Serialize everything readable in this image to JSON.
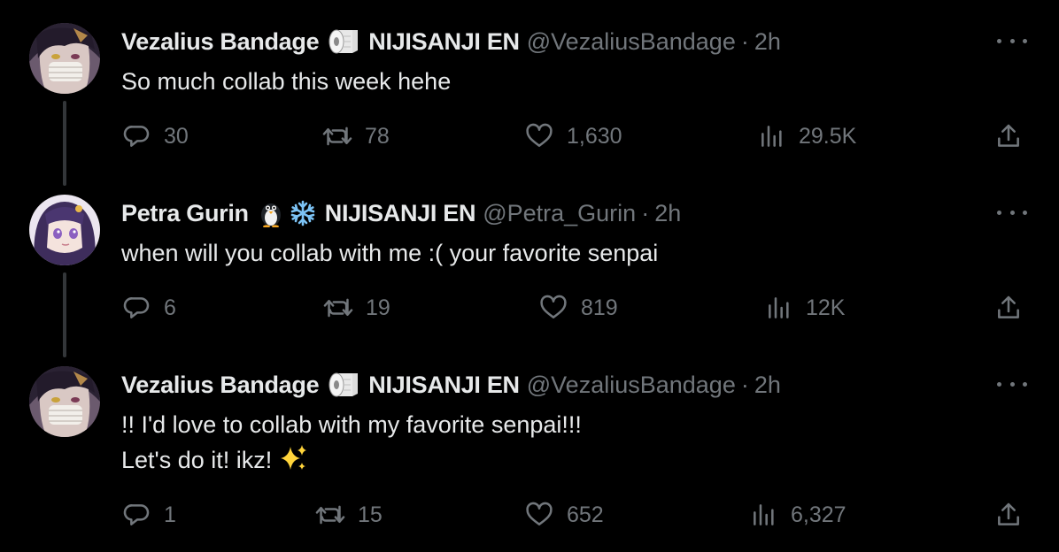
{
  "tweets": [
    {
      "name": "Vezalius Bandage",
      "badges": [
        "toilet-paper-roll-icon"
      ],
      "org": "NIJISANJI EN",
      "handle": "@VezaliusBandage",
      "separator": "·",
      "time": "2h",
      "lines": [
        "So much collab this week hehe"
      ],
      "stats": {
        "replies": "30",
        "retweets": "78",
        "likes": "1,630",
        "views": "29.5K"
      }
    },
    {
      "name": "Petra Gurin",
      "badges": [
        "penguin-icon",
        "snowflake-icon"
      ],
      "org": "NIJISANJI EN",
      "handle": "@Petra_Gurin",
      "separator": "·",
      "time": "2h",
      "lines": [
        "when will you collab with me :( your favorite senpai"
      ],
      "stats": {
        "replies": "6",
        "retweets": "19",
        "likes": "819",
        "views": "12K"
      }
    },
    {
      "name": "Vezalius Bandage",
      "badges": [
        "toilet-paper-roll-icon"
      ],
      "org": "NIJISANJI EN",
      "handle": "@VezaliusBandage",
      "separator": "·",
      "time": "2h",
      "lines": [
        "!! I'd love to collab with my favorite senpai!!!",
        "Let's do it! ikz!"
      ],
      "emoji": "sparkles-icon",
      "stats": {
        "replies": "1",
        "retweets": "15",
        "likes": "652",
        "views": "6,327"
      }
    }
  ],
  "colors": {
    "background": "#000000",
    "text": "#e7e9ea",
    "muted": "#71767b",
    "thread_line": "#333639",
    "sparkle": "#ffd43b"
  }
}
